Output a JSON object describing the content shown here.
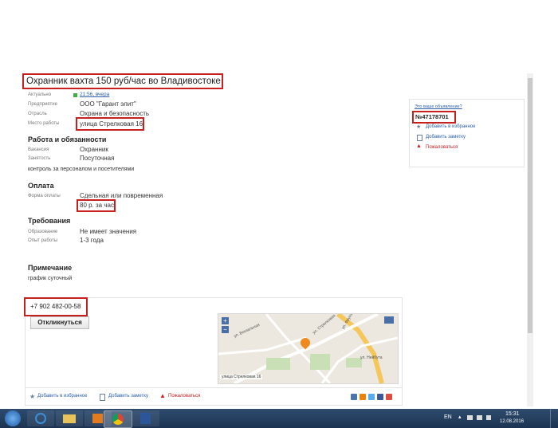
{
  "title": "Охранник вахта 150 руб/час во Владивостоке",
  "fields": [
    {
      "label": "Актуально",
      "value": "21:56, вчера"
    },
    {
      "label": "Предприятие",
      "value": "ООО \"Гарант элит\""
    },
    {
      "label": "Отрасль",
      "value": "Охрана и безопасность"
    },
    {
      "label": "Место работы",
      "value": "улица Стрелковая 16"
    }
  ],
  "duties": {
    "heading": "Работа и обязанности",
    "fields": [
      {
        "label": "Вакансия",
        "value": "Охранник"
      },
      {
        "label": "Занятость",
        "value": "Посуточная"
      }
    ],
    "description": "контроль за персоналом и посетителями"
  },
  "payment": {
    "heading": "Оплата",
    "label": "Форма оплаты",
    "value": "Сдельная или повременная",
    "rate": "80 р. за час"
  },
  "requirements": {
    "heading": "Требования",
    "fields": [
      {
        "label": "Образование",
        "value": "Не имеет значения"
      },
      {
        "label": "Опыт работы",
        "value": "1-3 года"
      }
    ]
  },
  "note": {
    "heading": "Примечание",
    "text": "график суточный"
  },
  "contact": {
    "phone": "+7 902 482-00-58",
    "respond_button": "Откликнуться",
    "map_address": "улица Стрелковая 16",
    "map_streets": [
      "ул. Стрелковая",
      "ул. Вокзальная",
      "ул. Нейбута",
      "ул. Фрунзе"
    ]
  },
  "footer_actions": [
    "Добавить в избранное",
    "Добавить заметку",
    "Пожаловаться"
  ],
  "sidebar": {
    "owner_question": "Это ваше объявление?",
    "ad_number": "№47178701",
    "actions": [
      "Добавить в избранное",
      "Добавить заметку",
      "Пожаловаться"
    ]
  },
  "taskbar": {
    "lang": "EN",
    "time": "15:31",
    "date": "12.08.2016"
  },
  "colors": {
    "highlight": "#c8201f",
    "link": "#2a5ea8",
    "status_green": "#3cb043"
  }
}
